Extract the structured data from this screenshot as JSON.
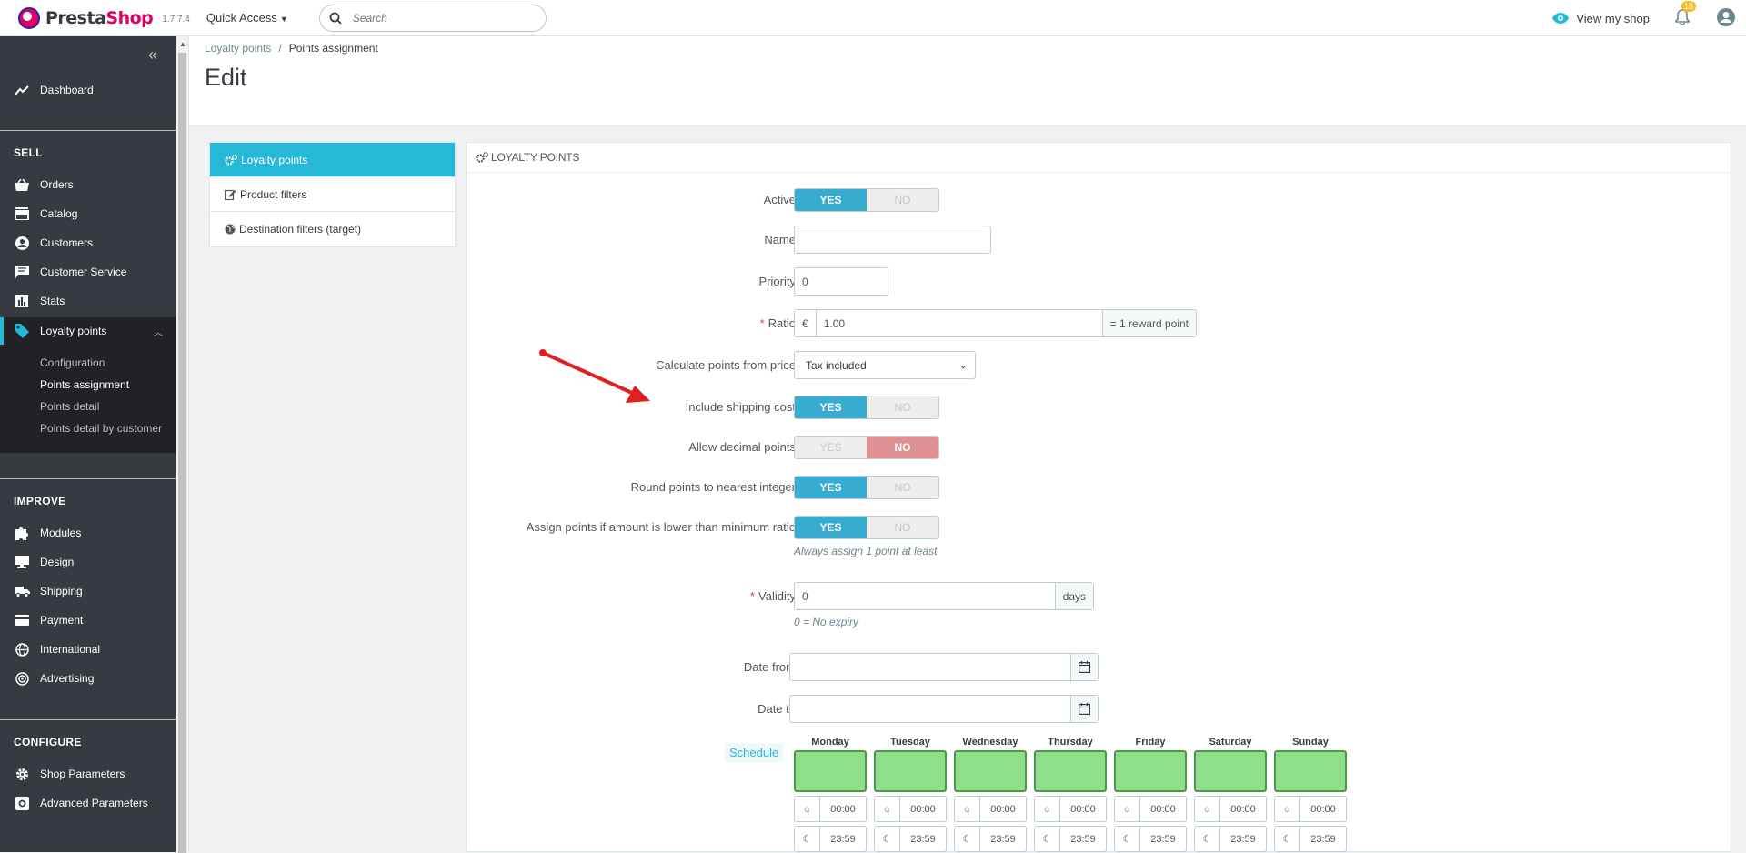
{
  "header": {
    "logo_prefix": "Presta",
    "logo_suffix": "Shop",
    "version": "1.7.7.4",
    "quick_access": "Quick Access",
    "search_placeholder": "Search",
    "view_shop": "View my shop",
    "notifications": "18"
  },
  "sidebar": {
    "dashboard": "Dashboard",
    "sections": {
      "sell": "SELL",
      "improve": "IMPROVE",
      "configure": "CONFIGURE"
    },
    "sell_items": [
      "Orders",
      "Catalog",
      "Customers",
      "Customer Service",
      "Stats",
      "Loyalty points"
    ],
    "loyalty_sub": [
      "Configuration",
      "Points assignment",
      "Points detail",
      "Points detail by customer"
    ],
    "improve_items": [
      "Modules",
      "Design",
      "Shipping",
      "Payment",
      "International",
      "Advertising"
    ],
    "configure_items": [
      "Shop Parameters",
      "Advanced Parameters"
    ]
  },
  "page": {
    "breadcrumb": [
      "Loyalty points",
      "Points assignment"
    ],
    "title": "Edit"
  },
  "tabs": [
    "Loyalty points",
    "Product filters",
    "Destination filters (target)"
  ],
  "panel": {
    "title": "LOYALTY POINTS",
    "switch_yes": "YES",
    "switch_no": "NO",
    "active_label": "Active",
    "name_label": "Name",
    "name_value": "",
    "priority_label": "Priority",
    "priority_value": "0",
    "ratio_label": "Ratio",
    "ratio_prefix": "€",
    "ratio_value": "1.00",
    "ratio_suffix": "= 1 reward point",
    "calc_label": "Calculate points from price",
    "calc_value": "Tax included",
    "shipping_label": "Include shipping cost",
    "decimal_label": "Allow decimal points",
    "round_label": "Round points to nearest integer",
    "assign_label": "Assign points if amount is lower than minimum ratio",
    "assign_help": "Always assign 1 point at least",
    "validity_label": "Validity",
    "validity_value": "0",
    "validity_suffix": "days",
    "validity_help": "0 = No expiry",
    "date_from_label": "Date from",
    "date_to_label": "Date to",
    "schedule_label": "Schedule",
    "days": [
      "Monday",
      "Tuesday",
      "Wednesday",
      "Thursday",
      "Friday",
      "Saturday",
      "Sunday"
    ],
    "start_time": "00:00",
    "end_time": "23:59"
  },
  "colors": {
    "accent": "#25b9d7",
    "sidebar": "#363a41",
    "yes": "#38acd0",
    "no": "#e08f95",
    "schedule_green": "#8fdf8a",
    "arrow": "#e02020"
  }
}
